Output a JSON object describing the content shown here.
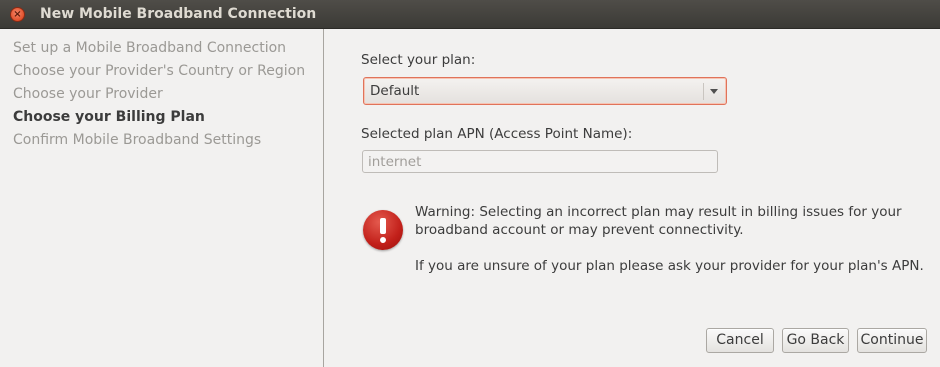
{
  "window": {
    "title": "New Mobile Broadband Connection"
  },
  "sidebar": {
    "steps": [
      {
        "label": "Set up a Mobile Broadband Connection",
        "active": false
      },
      {
        "label": "Choose your Provider's Country or Region",
        "active": false
      },
      {
        "label": "Choose your Provider",
        "active": false
      },
      {
        "label": "Choose your Billing Plan",
        "active": true
      },
      {
        "label": "Confirm Mobile Broadband Settings",
        "active": false
      }
    ]
  },
  "plan": {
    "label": "Select your plan:",
    "selected": "Default"
  },
  "apn": {
    "label": "Selected plan APN (Access Point Name):",
    "value": "internet"
  },
  "warning": {
    "icon": "error-icon",
    "line1": "Warning: Selecting an incorrect plan may result in billing issues for your",
    "line2": "broadband account or may prevent connectivity.",
    "line3": "If you are unsure of your plan please ask your provider for your plan's APN."
  },
  "buttons": {
    "cancel": "Cancel",
    "back": "Go Back",
    "continue": "Continue"
  },
  "colors": {
    "titlebar": "#3c3b37",
    "accent": "#e0735a",
    "error": "#c2201a"
  }
}
